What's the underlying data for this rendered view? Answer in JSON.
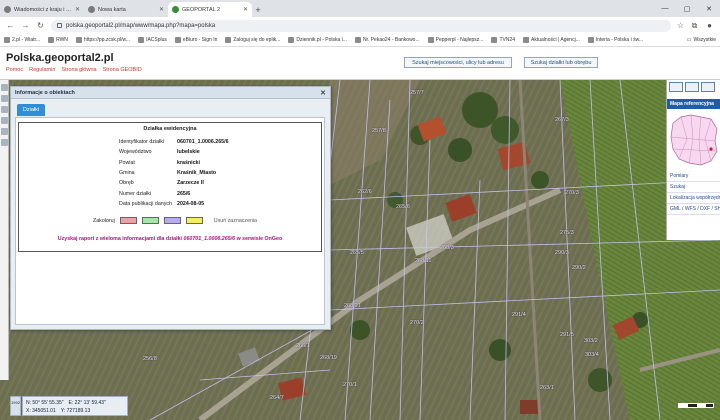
{
  "browser": {
    "tabs": [
      {
        "label": "Wiadomości z kraju i ze świata",
        "active": false
      },
      {
        "label": "Nowa karta",
        "active": false
      },
      {
        "label": "GEOPORTAL 2",
        "active": true
      }
    ],
    "url": "polska.geoportal2.pl/map/www/mapa.php?mapa=polska",
    "bookmarks": [
      "2.pl - Wiatr...",
      "RWN",
      "https://pp.zcsk.pl/w...",
      "IACSplus",
      "eBiuro - Sign In",
      "Zaloguj się do eplik...",
      "Dziennik.pl - Polska i...",
      "Nr. Pekao24 - Bankowo...",
      "Pepperpl - Najlepsz...",
      "TVN24",
      "Aktualności | Agencj...",
      "Interia - Polska i św..."
    ],
    "bookmarks_more": "Wszystkie"
  },
  "site": {
    "title": "Polska.geoportal2.pl",
    "links": [
      "Pomoc",
      "Regulamin",
      "Strona główna",
      "Strona GEOBID"
    ],
    "search_address_label": "Szukaj miejscowości, ulicy lub adresu",
    "search_parcel_label": "Szukaj działki lub obrębu"
  },
  "dialog": {
    "title": "Informacje o obiektach",
    "tab_label": "Działki",
    "panel_title": "Działka ewidencyjna",
    "fields": [
      {
        "label": "Identyfikator działki",
        "value": "060701_1.0006.265/6"
      },
      {
        "label": "Województwo",
        "value": "lubelskie"
      },
      {
        "label": "Powiat",
        "value": "kraśnicki"
      },
      {
        "label": "Gmina",
        "value": "Kraśnik_Miasto"
      },
      {
        "label": "Obręb",
        "value": "Zarzecze II"
      },
      {
        "label": "Numer działki",
        "value": "265/6"
      },
      {
        "label": "Data publikacji danych",
        "value": "2024-08-05"
      }
    ],
    "color_label": "Zakoloruj",
    "colors": [
      "#f2a0a6",
      "#a7e6a2",
      "#b4aef0",
      "#f5ec62"
    ],
    "clear_label": "Usuń zaznaczenia",
    "report_prefix": "Uzyskaj raport z wieloma informacjami dla działki",
    "report_id": "060701_1.0006.265/6",
    "report_suffix": "w serwisie OnGeo"
  },
  "right_panel": {
    "header": "Mapa referencyjna",
    "items": [
      "Pomiary",
      "Szukaj",
      "Lokalizacja współrzędnych",
      "GML / WFS / DXF / SHP"
    ]
  },
  "coords": {
    "side_label": "1992",
    "n": "N: 50° 55' 55.35\"",
    "e": "E: 22° 13' 59.43\"",
    "x": "X: 345051.01",
    "y": "Y: 727189.13"
  },
  "map_labels": [
    {
      "t": "257/7"
    },
    {
      "t": "257/8"
    },
    {
      "t": "262/6"
    },
    {
      "t": "265/6"
    },
    {
      "t": "265/5"
    },
    {
      "t": "267/3"
    },
    {
      "t": "268/3"
    },
    {
      "t": "268/11"
    },
    {
      "t": "268/21"
    },
    {
      "t": "268/19"
    },
    {
      "t": "270/1"
    },
    {
      "t": "270/2"
    },
    {
      "t": "270/3"
    },
    {
      "t": "290/2"
    },
    {
      "t": "290/3"
    },
    {
      "t": "291/4"
    },
    {
      "t": "291/5"
    },
    {
      "t": "256/8"
    },
    {
      "t": "266/1"
    },
    {
      "t": "275/3"
    },
    {
      "t": "303/2"
    },
    {
      "t": "303/4"
    },
    {
      "t": "263/1"
    },
    {
      "t": "264/7"
    }
  ]
}
